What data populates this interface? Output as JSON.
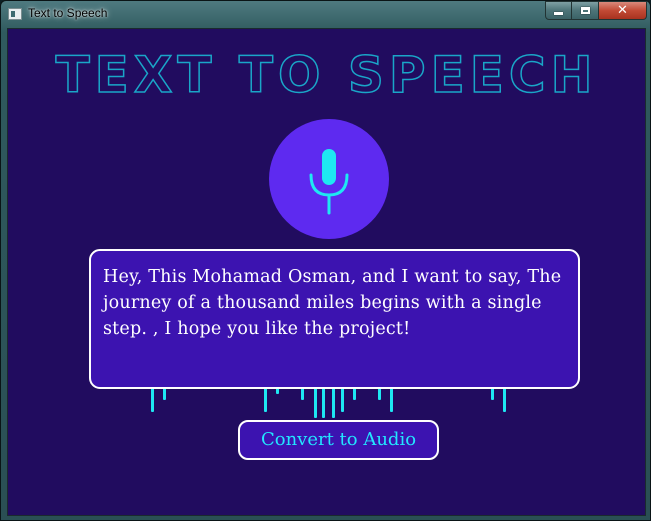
{
  "window": {
    "title": "Text to Speech",
    "buttons": {
      "minimize": "minimize",
      "maximize": "maximize",
      "close": "close"
    }
  },
  "app": {
    "heading": "TEXT TO SPEECH",
    "mic_icon": "microphone-icon",
    "text_content": "Hey, This Mohamad Osman, and I want to say, The journey of a thousand miles begins with a single step. , I hope you like the project!",
    "convert_button_label": "Convert to Audio"
  },
  "colors": {
    "background": "#210c5f",
    "accent_circle": "#5e2af0",
    "panel": "#3c13b0",
    "bars": "#1ee8f2",
    "heading_outline": "#1aa6c8",
    "button_text": "#22e6ff"
  }
}
